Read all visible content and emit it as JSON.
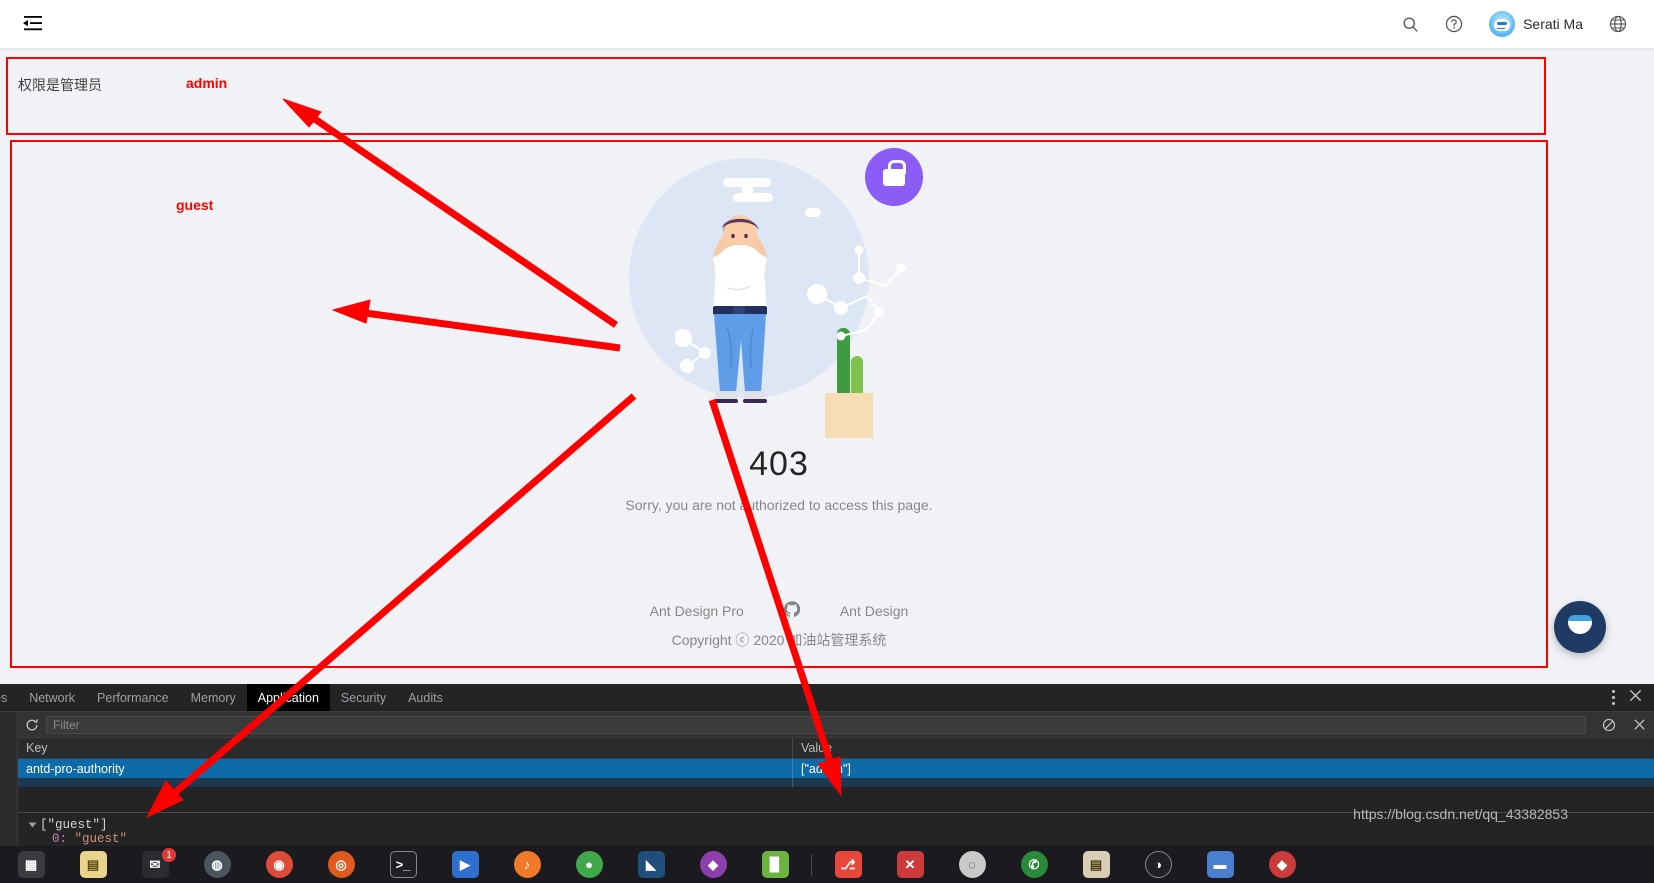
{
  "header": {
    "menu_icon": "menu-fold-icon",
    "search_icon": "search-icon",
    "help_icon": "question-circle-icon",
    "username": "Serati Ma",
    "globe_icon": "global-icon"
  },
  "annotations": {
    "admin": "admin",
    "guest": "guest",
    "color": "#ff0000"
  },
  "admin_section": {
    "label": "权限是管理员"
  },
  "result": {
    "code": "403",
    "message": "Sorry, you are not authorized to access this page.",
    "illustration": "403-forbidden-illustration",
    "lock_icon": "lock-icon",
    "lock_color": "#8b5cf6"
  },
  "footer": {
    "links": [
      {
        "label": "Ant Design Pro"
      },
      {
        "label": "github-icon"
      },
      {
        "label": "Ant Design"
      }
    ],
    "copyright": "Copyright ⓒ 2020 加油站管理系统"
  },
  "float_button": {
    "name": "settings-drawer-button"
  },
  "devtools": {
    "tabs": [
      {
        "label": "es",
        "active": false,
        "clipped": true
      },
      {
        "label": "Network",
        "active": false
      },
      {
        "label": "Performance",
        "active": false
      },
      {
        "label": "Memory",
        "active": false
      },
      {
        "label": "Application",
        "active": true
      },
      {
        "label": "Security",
        "active": false
      },
      {
        "label": "Audits",
        "active": false
      }
    ],
    "more_icon": "kebab-menu-icon",
    "close_icon": "close-icon",
    "toolbar": {
      "refresh_icon": "refresh-icon",
      "filter_placeholder": "Filter",
      "filter_value": "",
      "clear_icon": "clear-all-icon",
      "delete_icon": "delete-selected-icon"
    },
    "table": {
      "columns": [
        "Key",
        "Value"
      ],
      "rows": [
        {
          "key": "antd-pro-authority",
          "value": "[\"admin\"]",
          "selected": true
        }
      ]
    },
    "preview": {
      "root": "[\"guest\"]",
      "child_key": "0:",
      "child_value": "\"guest\""
    }
  },
  "taskbar": {
    "badge_count": "1",
    "items": [
      "start-icon",
      "folder-icon",
      "chrome-icon",
      "firefox-icon",
      "edge-icon",
      "terminal-icon",
      "vs-icon",
      "music-icon",
      "mail-icon",
      "vscode-icon",
      "purple-icon",
      "green-icon",
      "git-icon",
      "x-icon",
      "circle-icon",
      "yellow-icon",
      "files-icon",
      "ghost-icon",
      "blue-icon",
      "red-icon"
    ]
  },
  "watermark": "https://blog.csdn.net/qq_43382853"
}
